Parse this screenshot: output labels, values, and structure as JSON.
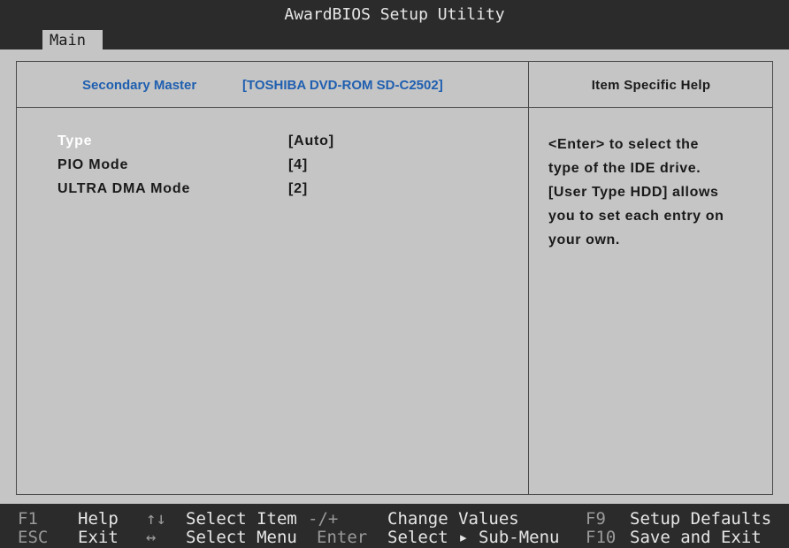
{
  "window": {
    "title": "AwardBIOS Setup Utility"
  },
  "menu": {
    "active_tab": "Main"
  },
  "header": {
    "label": "Secondary Master",
    "value": "[TOSHIBA DVD-ROM SD-C2502]",
    "help_title": "Item Specific Help"
  },
  "options": [
    {
      "label": "Type",
      "value": "[Auto]",
      "selected": true
    },
    {
      "label": "PIO Mode",
      "value": "[4]",
      "selected": false
    },
    {
      "label": "ULTRA DMA Mode",
      "value": "[2]",
      "selected": false
    }
  ],
  "help": {
    "lines": [
      "<Enter> to select the",
      "type of the IDE drive.",
      "[User Type HDD] allows",
      "you to set each entry on",
      "your own."
    ]
  },
  "footer": {
    "row1": [
      {
        "key": "F1",
        "desc": "Help"
      },
      {
        "key": "↑↓",
        "desc": "Select Item"
      },
      {
        "key": "-/+",
        "desc": "Change Values"
      },
      {
        "key": "F9",
        "desc": "Setup Defaults"
      }
    ],
    "row2": [
      {
        "key": "ESC",
        "desc": "Exit"
      },
      {
        "key": "↔",
        "desc": "Select Menu"
      },
      {
        "key": "Enter",
        "desc": "Select ▸ Sub-Menu"
      },
      {
        "key": "F10",
        "desc": "Save and Exit"
      }
    ]
  },
  "colors": {
    "background": "#c5c5c5",
    "bar": "#2b2b2b",
    "header_text": "#1f5fb0",
    "selected_text": "#ffffff",
    "footer_key": "#9a9a9a"
  }
}
